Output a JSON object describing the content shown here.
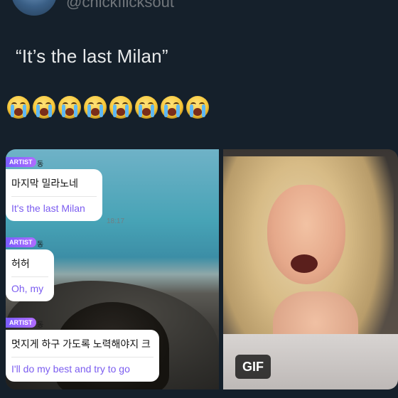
{
  "author": {
    "handle": "@chickflicksout"
  },
  "tweet": {
    "text": "“It’s the last Milan”",
    "emoji_count": 8,
    "emoji_icon": "loudly-crying-face-icon"
  },
  "media": {
    "left": {
      "messages": [
        {
          "tag": "ARTIST",
          "name": "동",
          "korean": "마지막 밀라노네",
          "english": "It's the last Milan",
          "time": "18:17"
        },
        {
          "tag": "ARTIST",
          "name": "동",
          "korean": "허허",
          "english": "Oh, my",
          "time": ""
        },
        {
          "tag": "ARTIST",
          "name": "동",
          "korean": "멋지게 하구 가도록 노력해야지 크",
          "english": "I'll do my best and try to go",
          "time": ""
        }
      ]
    },
    "right": {
      "badge": "GIF"
    }
  }
}
